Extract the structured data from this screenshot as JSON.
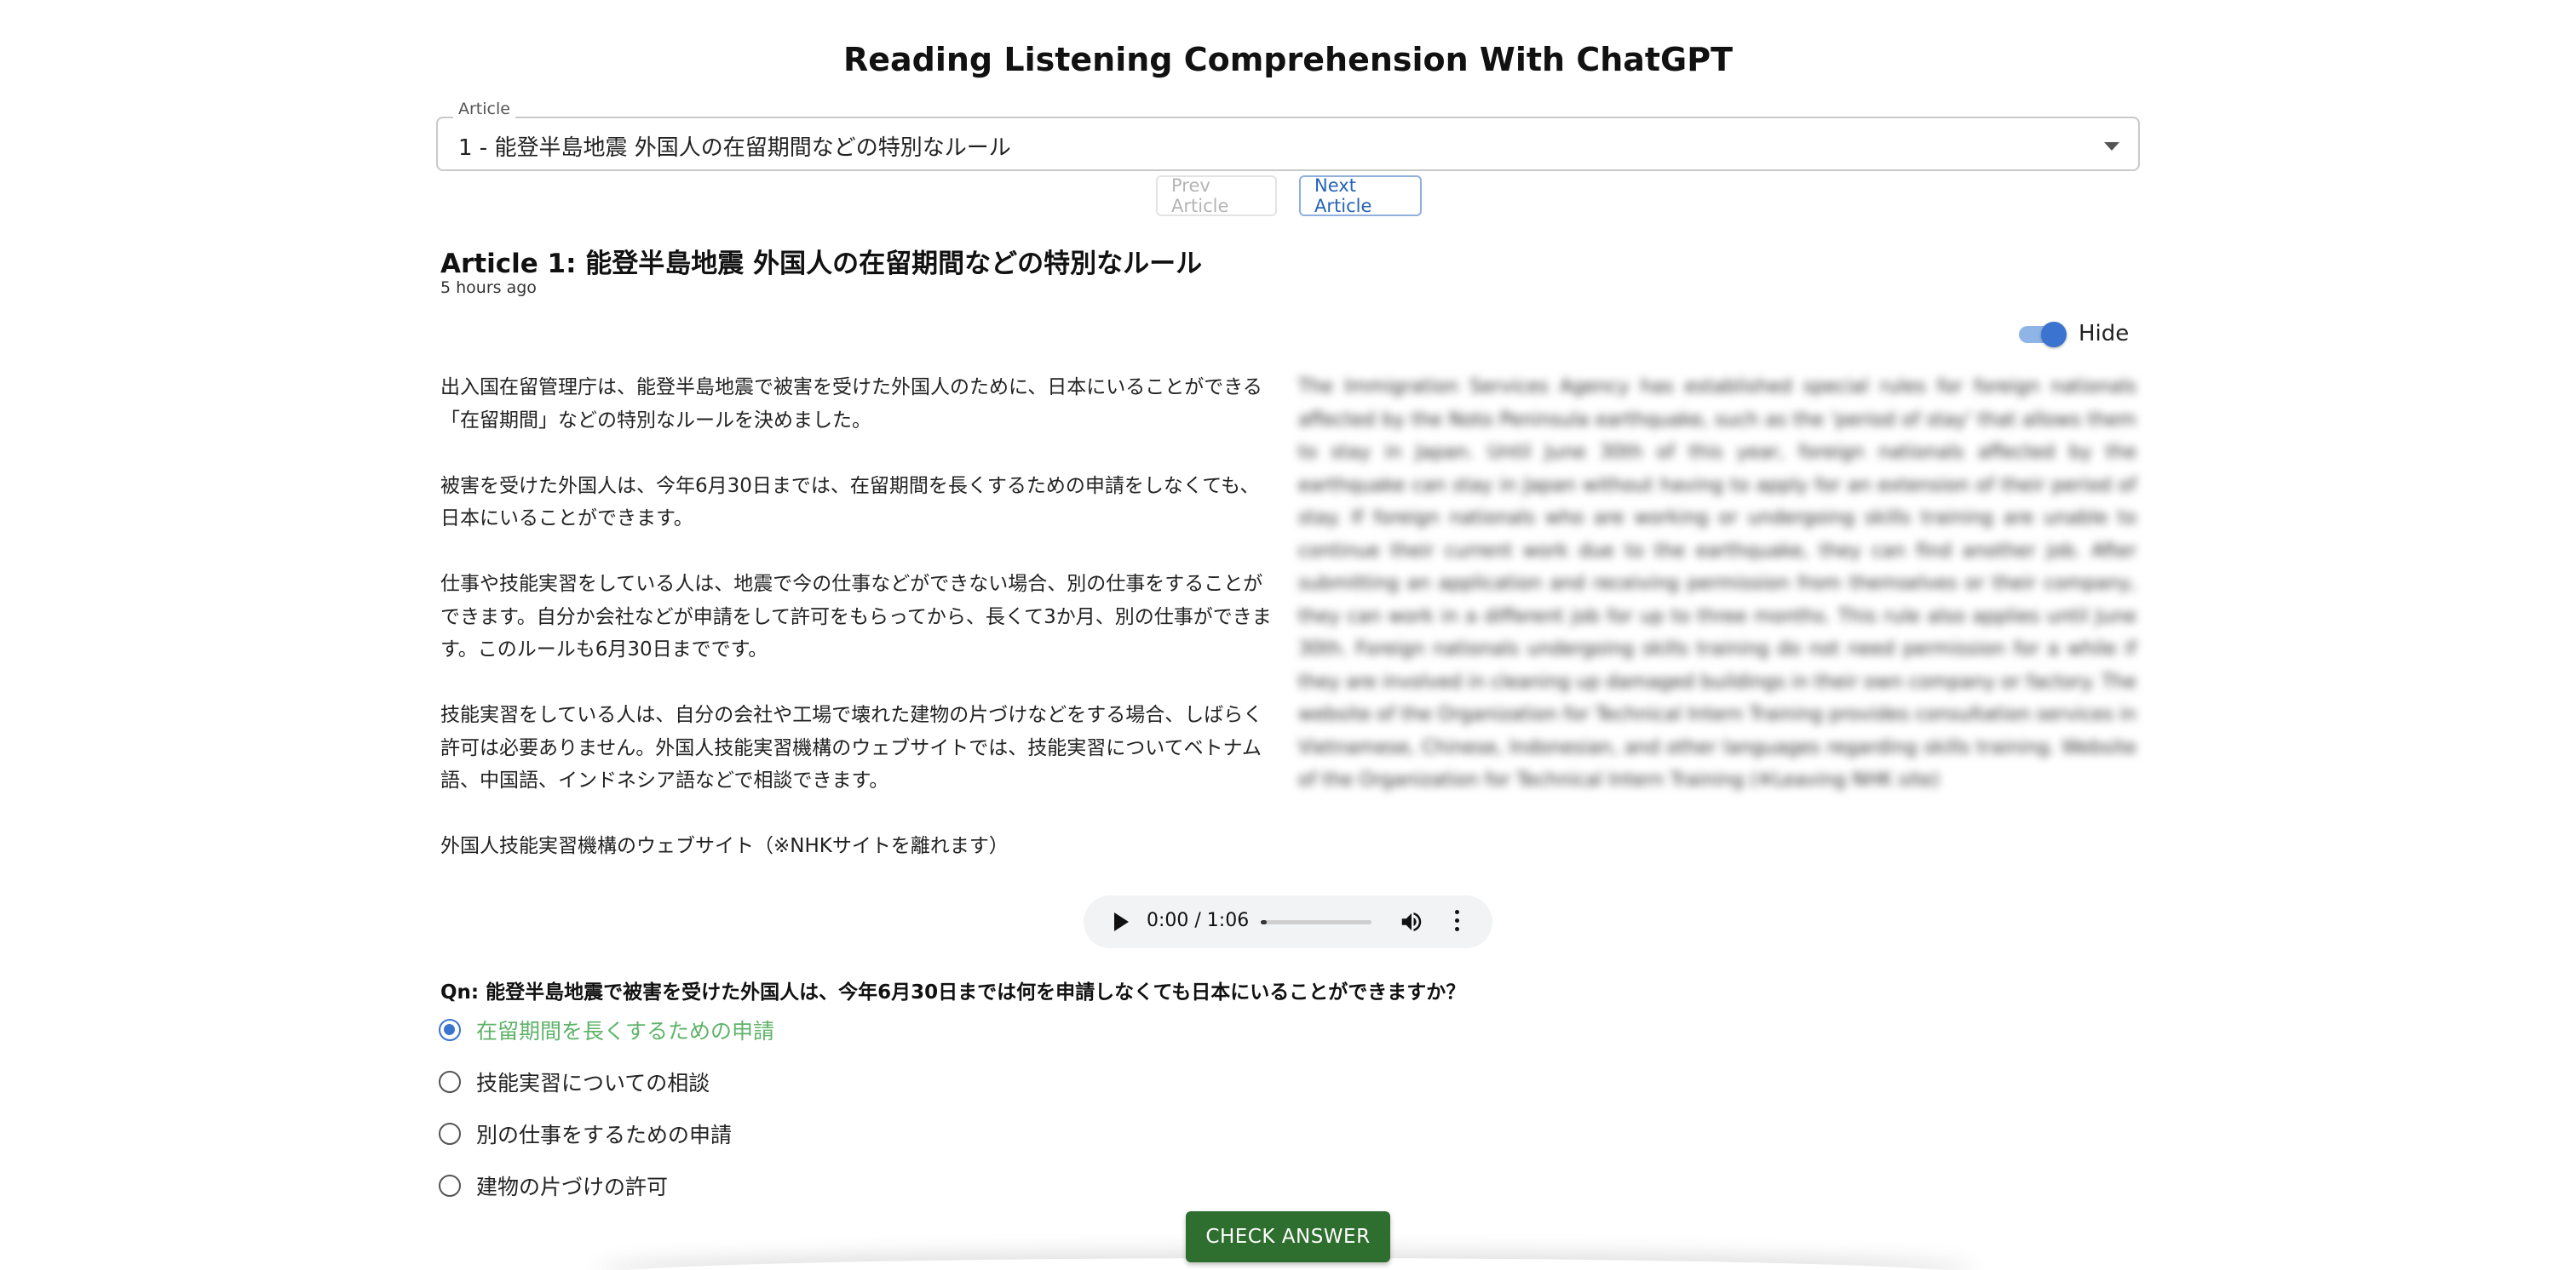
{
  "page": {
    "title": "Reading Listening Comprehension With ChatGPT"
  },
  "selector": {
    "legend": "Article",
    "value": "1 - 能登半島地震 外国人の在留期間などの特別なルール"
  },
  "nav": {
    "prev_label": "Prev Article",
    "next_label": "Next Article"
  },
  "article": {
    "title": "Article 1: 能登半島地震 外国人の在留期間などの特別なルール",
    "time": "5 hours ago",
    "toggle_label": "Hide",
    "paragraphs": [
      "出入国在留管理庁は、能登半島地震で被害を受けた外国人のために、日本にいることができる「在留期間」などの特別なルールを決めました。",
      "被害を受けた外国人は、今年6月30日までは、在留期間を長くするための申請をしなくても、日本にいることができます。",
      "仕事や技能実習をしている人は、地震で今の仕事などができない場合、別の仕事をすることができます。自分か会社などが申請をして許可をもらってから、長くて3か月、別の仕事ができます。このルールも6月30日までです。",
      "技能実習をしている人は、自分の会社や工場で壊れた建物の片づけなどをする場合、しばらく許可は必要ありません。外国人技能実習機構のウェブサイトでは、技能実習についてベトナム語、中国語、インドネシア語などで相談できます。",
      "外国人技能実習機構のウェブサイト（※NHKサイトを離れます）"
    ],
    "translation": "The Immigration Services Agency has established special rules for foreign nationals affected by the Noto Peninsula earthquake, such as the 'period of stay' that allows them to stay in Japan. Until June 30th of this year, foreign nationals affected by the earthquake can stay in Japan without having to apply for an extension of their period of stay. If foreign nationals who are working or undergoing skills training are unable to continue their current work due to the earthquake, they can find another job. After submitting an application and receiving permission from themselves or their company, they can work in a different job for up to three months. This rule also applies until June 30th. Foreign nationals undergoing skills training do not need permission for a while if they are involved in cleaning up damaged buildings in their own company or factory. The website of the Organization for Technical Intern Training provides consultation services in Vietnamese, Chinese, Indonesian, and other languages regarding skills training. Website of the Organization for Technical Intern Training (※Leaving NHK site)"
  },
  "audio": {
    "time": "0:00 / 1:06",
    "progress": 0.05
  },
  "quiz": {
    "question": "Qn: 能登半島地震で被害を受けた外国人は、今年6月30日までは何を申請しなくても日本にいることができますか？",
    "options": [
      "在留期間を長くするための申請",
      "技能実習についての相談",
      "別の仕事をするための申請",
      "建物の片づけの許可"
    ],
    "selected_index": 0,
    "check_label": "CHECK ANSWER"
  },
  "colors": {
    "accent": "#3a74d0",
    "correct": "#5fb36a",
    "check_button": "#2e6e2e"
  },
  "icons": {
    "play": "play-icon",
    "volume": "volume-icon",
    "more": "more-vert-icon",
    "dropdown": "chevron-down-icon"
  }
}
